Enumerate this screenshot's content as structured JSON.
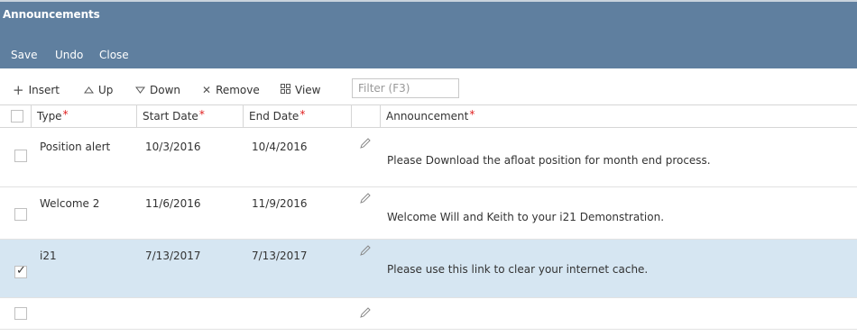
{
  "window": {
    "title": "Announcements"
  },
  "actions": {
    "save": "Save",
    "undo": "Undo",
    "close": "Close"
  },
  "toolbar": {
    "insert": "Insert",
    "up": "Up",
    "down": "Down",
    "remove": "Remove",
    "view": "View",
    "filter_placeholder": "Filter (F3)"
  },
  "grid": {
    "columns": {
      "type": "Type",
      "start_date": "Start Date",
      "end_date": "End Date",
      "announcement": "Announcement"
    },
    "rows": [
      {
        "type": "Position alert",
        "start": "10/3/2016",
        "end": "10/4/2016",
        "announcement": "Please Download the afloat position for month end process.",
        "checked": false
      },
      {
        "type": "Welcome 2",
        "start": "11/6/2016",
        "end": "11/9/2016",
        "announcement": "Welcome Will and Keith to your i21 Demonstration.",
        "checked": false
      },
      {
        "type": "i21",
        "start": "7/13/2017",
        "end": "7/13/2017",
        "announcement": "Please use this link to clear your internet cache.",
        "checked": true
      },
      {
        "type": "",
        "start": "",
        "end": "",
        "announcement": "",
        "checked": false
      }
    ]
  },
  "colors": {
    "header_bg": "#5f7f9f",
    "selected_row": "#d6e6f2",
    "required_mark": "#e02020"
  },
  "icons": {
    "insert": "plus-icon",
    "up": "triangle-up-icon",
    "down": "triangle-down-icon",
    "remove": "x-icon",
    "view": "grid-icon",
    "edit": "pencil-icon"
  }
}
